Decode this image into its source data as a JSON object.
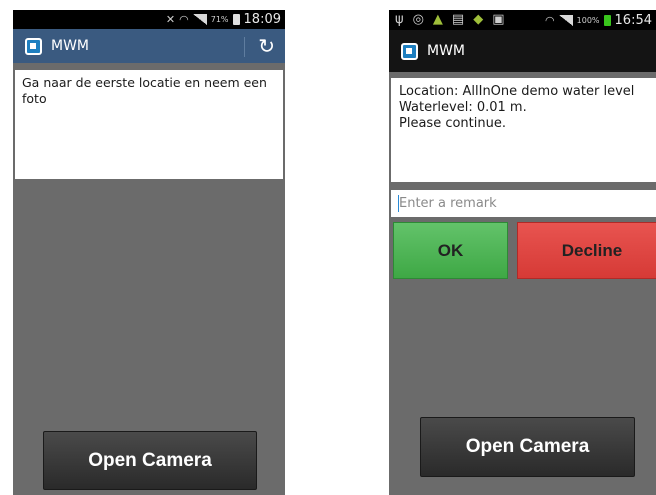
{
  "screens": [
    {
      "status": {
        "percent": "71%",
        "time": "18:09"
      },
      "app_title": "MWM",
      "message": "Ga naar de eerste locatie en neem een foto",
      "camera_label": "Open Camera"
    },
    {
      "status": {
        "percent": "100%",
        "time": "16:54"
      },
      "app_title": "MWM",
      "message_lines": [
        "Location: AllInOne demo water level",
        "Waterlevel: 0.01 m.",
        "Please continue."
      ],
      "remark_placeholder": "Enter a remark",
      "ok_label": "OK",
      "decline_label": "Decline",
      "camera_label": "Open Camera"
    }
  ],
  "icons": {
    "status_left_screen2": [
      "usb-icon",
      "gps-icon",
      "android-icon",
      "document-icon",
      "android-icon",
      "clipboard-icon"
    ],
    "status_right": [
      "wifi-icon",
      "signal-icon",
      "battery-icon"
    ],
    "action_bar": [
      "app-icon",
      "refresh-icon"
    ]
  },
  "colors": {
    "action_bar_blue": "#3a5a80",
    "ok_green": "#4caf50",
    "decline_red": "#e04743"
  }
}
